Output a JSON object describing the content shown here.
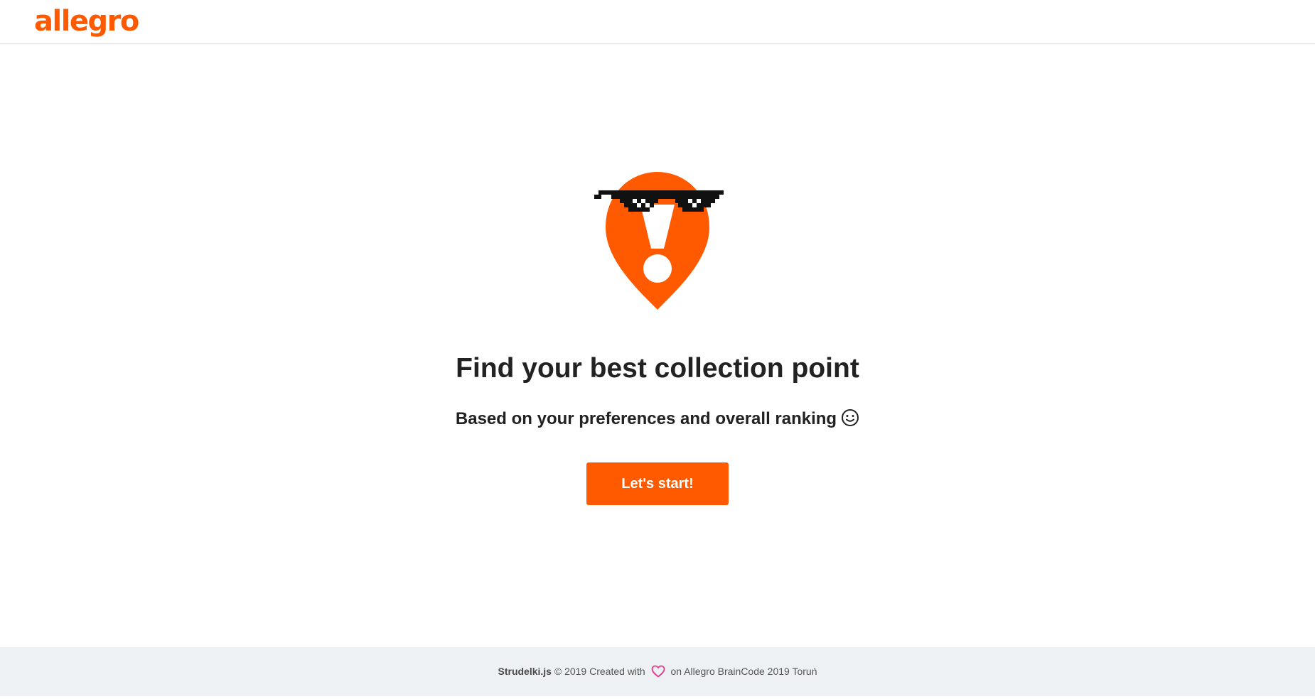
{
  "header": {
    "logo_text": "allegro"
  },
  "hero": {
    "illustration_icon": "location-pin-with-pixel-sunglasses-icon",
    "title": "Find your best collection point",
    "subtitle": "Based on your preferences and overall ranking",
    "subtitle_icon": "smiley-icon",
    "cta_label": "Let's start!"
  },
  "footer": {
    "brand": "Strudelki.js",
    "text_before_heart": "© 2019 Created with",
    "heart_icon": "heart-icon",
    "text_after_heart": "on Allegro BrainCode 2019 Toruń"
  },
  "colors": {
    "accent": "#ff5a00",
    "heart": "#e8388a",
    "footer_bg": "#eef1f4",
    "text": "#222222"
  }
}
